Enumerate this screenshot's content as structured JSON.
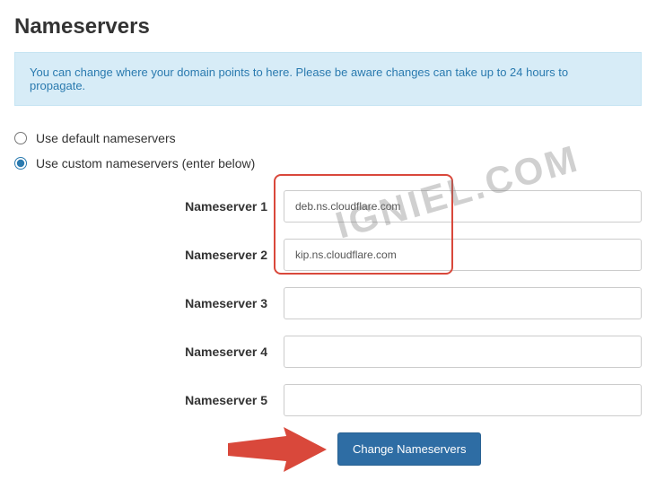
{
  "title": "Nameservers",
  "info_message": "You can change where your domain points to here. Please be aware changes can take up to 24 hours to propagate.",
  "radio_options": {
    "default_label": "Use default nameservers",
    "custom_label": "Use custom nameservers (enter below)",
    "selected": "custom"
  },
  "nameservers": [
    {
      "label": "Nameserver 1",
      "value": "deb.ns.cloudflare.com"
    },
    {
      "label": "Nameserver 2",
      "value": "kip.ns.cloudflare.com"
    },
    {
      "label": "Nameserver 3",
      "value": ""
    },
    {
      "label": "Nameserver 4",
      "value": ""
    },
    {
      "label": "Nameserver 5",
      "value": ""
    }
  ],
  "submit_label": "Change Nameservers",
  "watermark": "IGNIEL.COM"
}
